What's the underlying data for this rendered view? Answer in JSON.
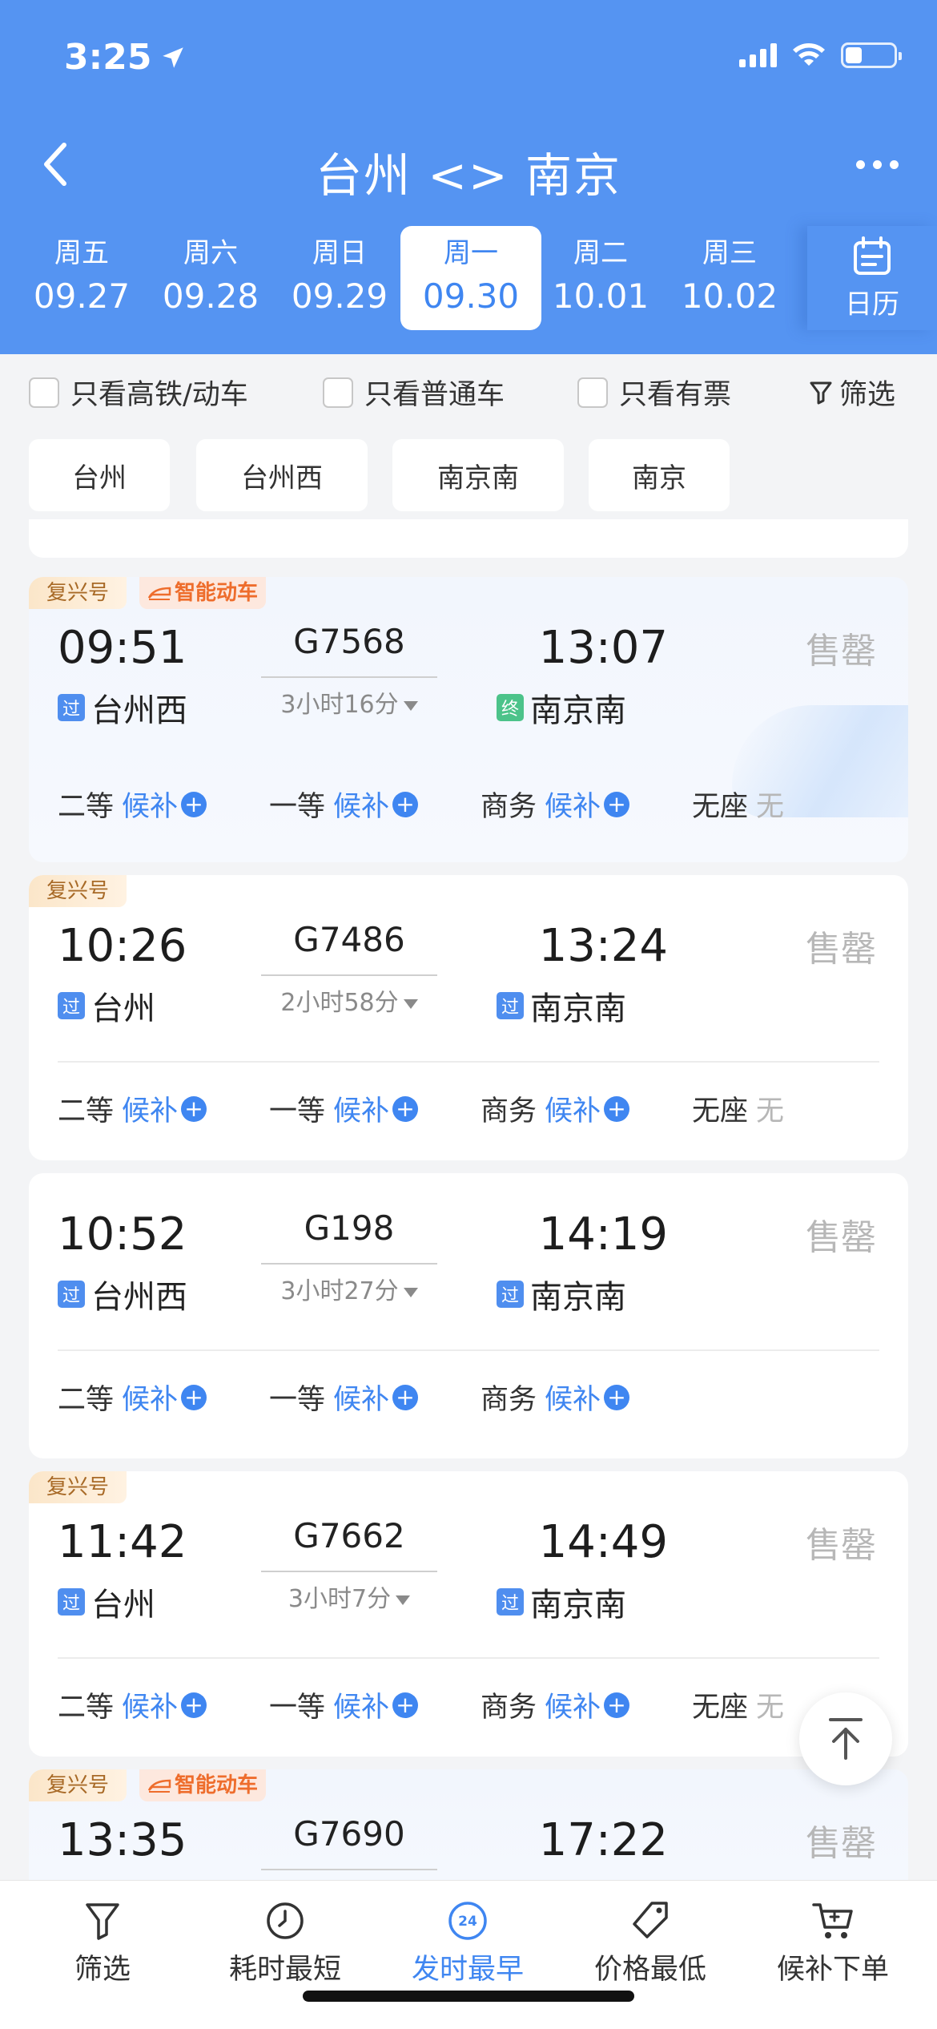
{
  "status_bar": {
    "time": "3:25",
    "battery_level": 0.35
  },
  "nav": {
    "title": "台州 <> 南京"
  },
  "dates": [
    {
      "weekday": "周五",
      "date": "09.27",
      "selected": false
    },
    {
      "weekday": "周六",
      "date": "09.28",
      "selected": false
    },
    {
      "weekday": "周日",
      "date": "09.29",
      "selected": false
    },
    {
      "weekday": "周一",
      "date": "09.30",
      "selected": true
    },
    {
      "weekday": "周二",
      "date": "10.01",
      "selected": false
    },
    {
      "weekday": "周三",
      "date": "10.02",
      "selected": false
    }
  ],
  "calendar_label": "日历",
  "filters": {
    "high_speed_only": "只看高铁/动车",
    "regular_only": "只看普通车",
    "available_only": "只看有票",
    "filter_link": "筛选"
  },
  "stations": [
    "台州",
    "台州西",
    "南京南",
    "南京"
  ],
  "trains": [
    {
      "tags": [
        "复兴号",
        "智能动车"
      ],
      "dep_time": "09:51",
      "train_no": "G7568",
      "duration": "3小时16分",
      "arr_time": "13:07",
      "dep_badge": "过",
      "dep_station": "台州西",
      "arr_badge": "终",
      "arr_station": "南京南",
      "status": "售罄",
      "seats": [
        {
          "class": "二等",
          "state": "候补"
        },
        {
          "class": "一等",
          "state": "候补"
        },
        {
          "class": "商务",
          "state": "候补"
        },
        {
          "class": "无座",
          "state": "无"
        }
      ]
    },
    {
      "tags": [
        "复兴号"
      ],
      "dep_time": "10:26",
      "train_no": "G7486",
      "duration": "2小时58分",
      "arr_time": "13:24",
      "dep_badge": "过",
      "dep_station": "台州",
      "arr_badge": "过",
      "arr_station": "南京南",
      "status": "售罄",
      "seats": [
        {
          "class": "二等",
          "state": "候补"
        },
        {
          "class": "一等",
          "state": "候补"
        },
        {
          "class": "商务",
          "state": "候补"
        },
        {
          "class": "无座",
          "state": "无"
        }
      ]
    },
    {
      "tags": [],
      "dep_time": "10:52",
      "train_no": "G198",
      "duration": "3小时27分",
      "arr_time": "14:19",
      "dep_badge": "过",
      "dep_station": "台州西",
      "arr_badge": "过",
      "arr_station": "南京南",
      "status": "售罄",
      "seats": [
        {
          "class": "二等",
          "state": "候补"
        },
        {
          "class": "一等",
          "state": "候补"
        },
        {
          "class": "商务",
          "state": "候补"
        }
      ]
    },
    {
      "tags": [
        "复兴号"
      ],
      "dep_time": "11:42",
      "train_no": "G7662",
      "duration": "3小时7分",
      "arr_time": "14:49",
      "dep_badge": "过",
      "dep_station": "台州",
      "arr_badge": "过",
      "arr_station": "南京南",
      "status": "售罄",
      "seats": [
        {
          "class": "二等",
          "state": "候补"
        },
        {
          "class": "一等",
          "state": "候补"
        },
        {
          "class": "商务",
          "state": "候补"
        },
        {
          "class": "无座",
          "state": "无"
        }
      ]
    },
    {
      "tags": [
        "复兴号",
        "智能动车"
      ],
      "dep_time": "13:35",
      "train_no": "G7690",
      "duration": "",
      "arr_time": "17:22",
      "status": "售罄"
    }
  ],
  "tabs": [
    {
      "label": "筛选",
      "icon": "funnel-icon",
      "active": false
    },
    {
      "label": "耗时最短",
      "icon": "clock-icon",
      "active": false
    },
    {
      "label": "发时最早",
      "icon": "24h-icon",
      "active": true
    },
    {
      "label": "价格最低",
      "icon": "price-tag-icon",
      "active": false
    },
    {
      "label": "候补下单",
      "icon": "cart-icon",
      "active": false
    }
  ],
  "colors": {
    "header_blue": "#5594f2",
    "accent_blue": "#3f86f1",
    "sold_out_gray": "#b7b7b7"
  }
}
